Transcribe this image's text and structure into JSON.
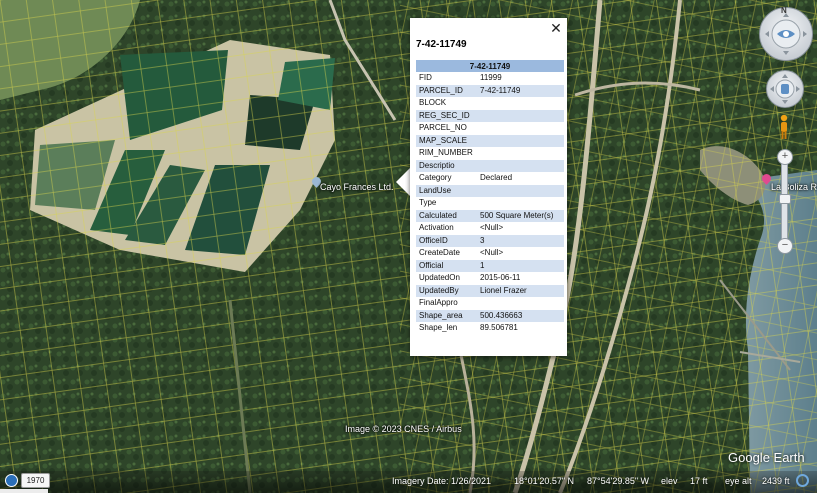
{
  "map": {
    "place_labels": [
      "Cayo Frances Ltd.",
      "La Boliza R"
    ],
    "copyright": "Image © 2023 CNES / Airbus",
    "brand": "Google Earth"
  },
  "popup": {
    "title": "7-42-11749",
    "close_label": "✕",
    "table_header": "7-42-11749",
    "rows": [
      {
        "key": "FID",
        "value": "11999"
      },
      {
        "key": "PARCEL_ID",
        "value": "7-42-11749"
      },
      {
        "key": "BLOCK",
        "value": ""
      },
      {
        "key": "REG_SEC_ID",
        "value": ""
      },
      {
        "key": "PARCEL_NO",
        "value": ""
      },
      {
        "key": "MAP_SCALE",
        "value": ""
      },
      {
        "key": "RIM_NUMBER",
        "value": ""
      },
      {
        "key": "Descriptio",
        "value": ""
      },
      {
        "key": "Category",
        "value": "Declared"
      },
      {
        "key": "LandUse",
        "value": ""
      },
      {
        "key": "Type",
        "value": ""
      },
      {
        "key": "Calculated",
        "value": "500 Square Meter(s)"
      },
      {
        "key": "Activation",
        "value": "<Null>"
      },
      {
        "key": "OfficeID",
        "value": "3"
      },
      {
        "key": "CreateDate",
        "value": "<Null>"
      },
      {
        "key": "Official",
        "value": "1"
      },
      {
        "key": "UpdatedOn",
        "value": "2015-06-11"
      },
      {
        "key": "UpdatedBy",
        "value": "Lionel Frazer"
      },
      {
        "key": "FinalAppro",
        "value": ""
      },
      {
        "key": "Shape_area",
        "value": "500.436663"
      },
      {
        "key": "Shape_len",
        "value": "89.506781"
      }
    ]
  },
  "controls": {
    "compass_north": "N",
    "zoom_in": "+",
    "zoom_out": "−"
  },
  "statusbar": {
    "history_year": "1970",
    "imagery_date": "Imagery Date: 1/26/2021",
    "latitude": "18°01'20.57\" N",
    "longitude": "87°54'29.85\" W",
    "elev_label": "elev",
    "elev_value": "17 ft",
    "eye_alt": "eye alt",
    "eye_alt_value": "2439 ft"
  },
  "colors": {
    "vegetation": "#2f4a2a",
    "parcel_lines": "#e6e04a",
    "pond": "#1f5a3a",
    "table_header": "#9bb9de",
    "table_alt_row": "#d5e1f1"
  }
}
